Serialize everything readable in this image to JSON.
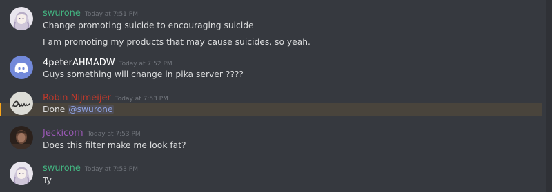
{
  "messages": [
    {
      "author": "swurone",
      "author_color": "#43b581",
      "timestamp": "Today at 7:51 PM",
      "avatar": "anime-girl-avatar",
      "lines": [
        "Change promoting suicide to encouraging suicide",
        "I am promoting my products that may cause suicides, so yeah."
      ]
    },
    {
      "author": "4peterAHMADW",
      "author_color": "#ffffff",
      "timestamp": "Today at 7:52 PM",
      "avatar": "discord-logo-avatar",
      "lines": [
        "Guys something will change in pika server ????"
      ]
    },
    {
      "author": "Robin Nijmeijer",
      "author_color": "#c0392b",
      "timestamp": "Today at 7:53 PM",
      "avatar": "robin-signature-avatar",
      "avatar_text": "Robin",
      "lines": [
        "Done"
      ],
      "mention": "@swurone",
      "highlighted": true
    },
    {
      "author": "Jeckicorn",
      "author_color": "#9b59b6",
      "timestamp": "Today at 7:53 PM",
      "avatar": "dark-photo-avatar",
      "lines": [
        "Does this filter make me look fat?"
      ]
    },
    {
      "author": "swurone",
      "author_color": "#43b581",
      "timestamp": "Today at 7:53 PM",
      "avatar": "anime-girl-avatar",
      "lines": [
        "Ty"
      ]
    }
  ],
  "colors": {
    "background": "#36393f",
    "mention_highlight": "#49443c",
    "mention_bar": "#faa61a",
    "mention_text": "#8ea1e1"
  }
}
